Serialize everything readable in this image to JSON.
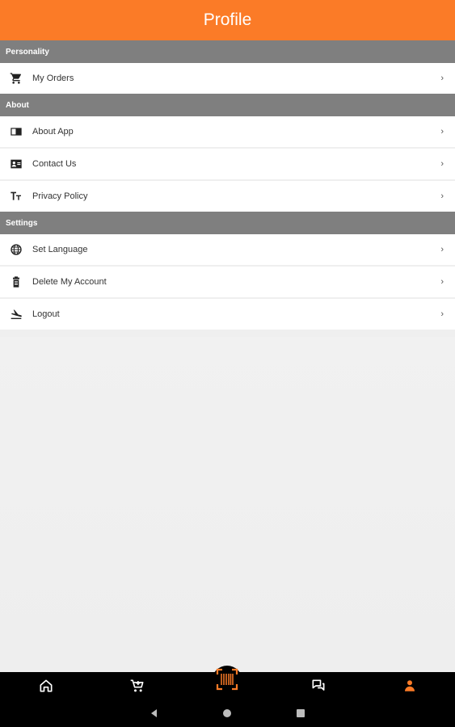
{
  "header": {
    "title": "Profile"
  },
  "sections": [
    {
      "title": "Personality",
      "items": [
        {
          "label": "My Orders",
          "icon": "cart-icon"
        }
      ]
    },
    {
      "title": "About",
      "items": [
        {
          "label": "About App",
          "icon": "book-icon"
        },
        {
          "label": "Contact Us",
          "icon": "contact-card-icon"
        },
        {
          "label": "Privacy Policy",
          "icon": "text-format-icon"
        }
      ]
    },
    {
      "title": "Settings",
      "items": [
        {
          "label": "Set Language",
          "icon": "globe-icon"
        },
        {
          "label": "Delete My Account",
          "icon": "delete-icon"
        },
        {
          "label": "Logout",
          "icon": "logout-icon"
        }
      ]
    }
  ],
  "chevron": "›",
  "bottom_nav": {
    "items": [
      "home-icon",
      "cart-add-icon",
      "barcode-scan-icon",
      "chat-icon",
      "profile-icon"
    ],
    "active": "profile-icon",
    "active_color": "#fb7b27"
  },
  "colors": {
    "accent": "#fb7b27",
    "section_header": "#7f7f7f"
  }
}
